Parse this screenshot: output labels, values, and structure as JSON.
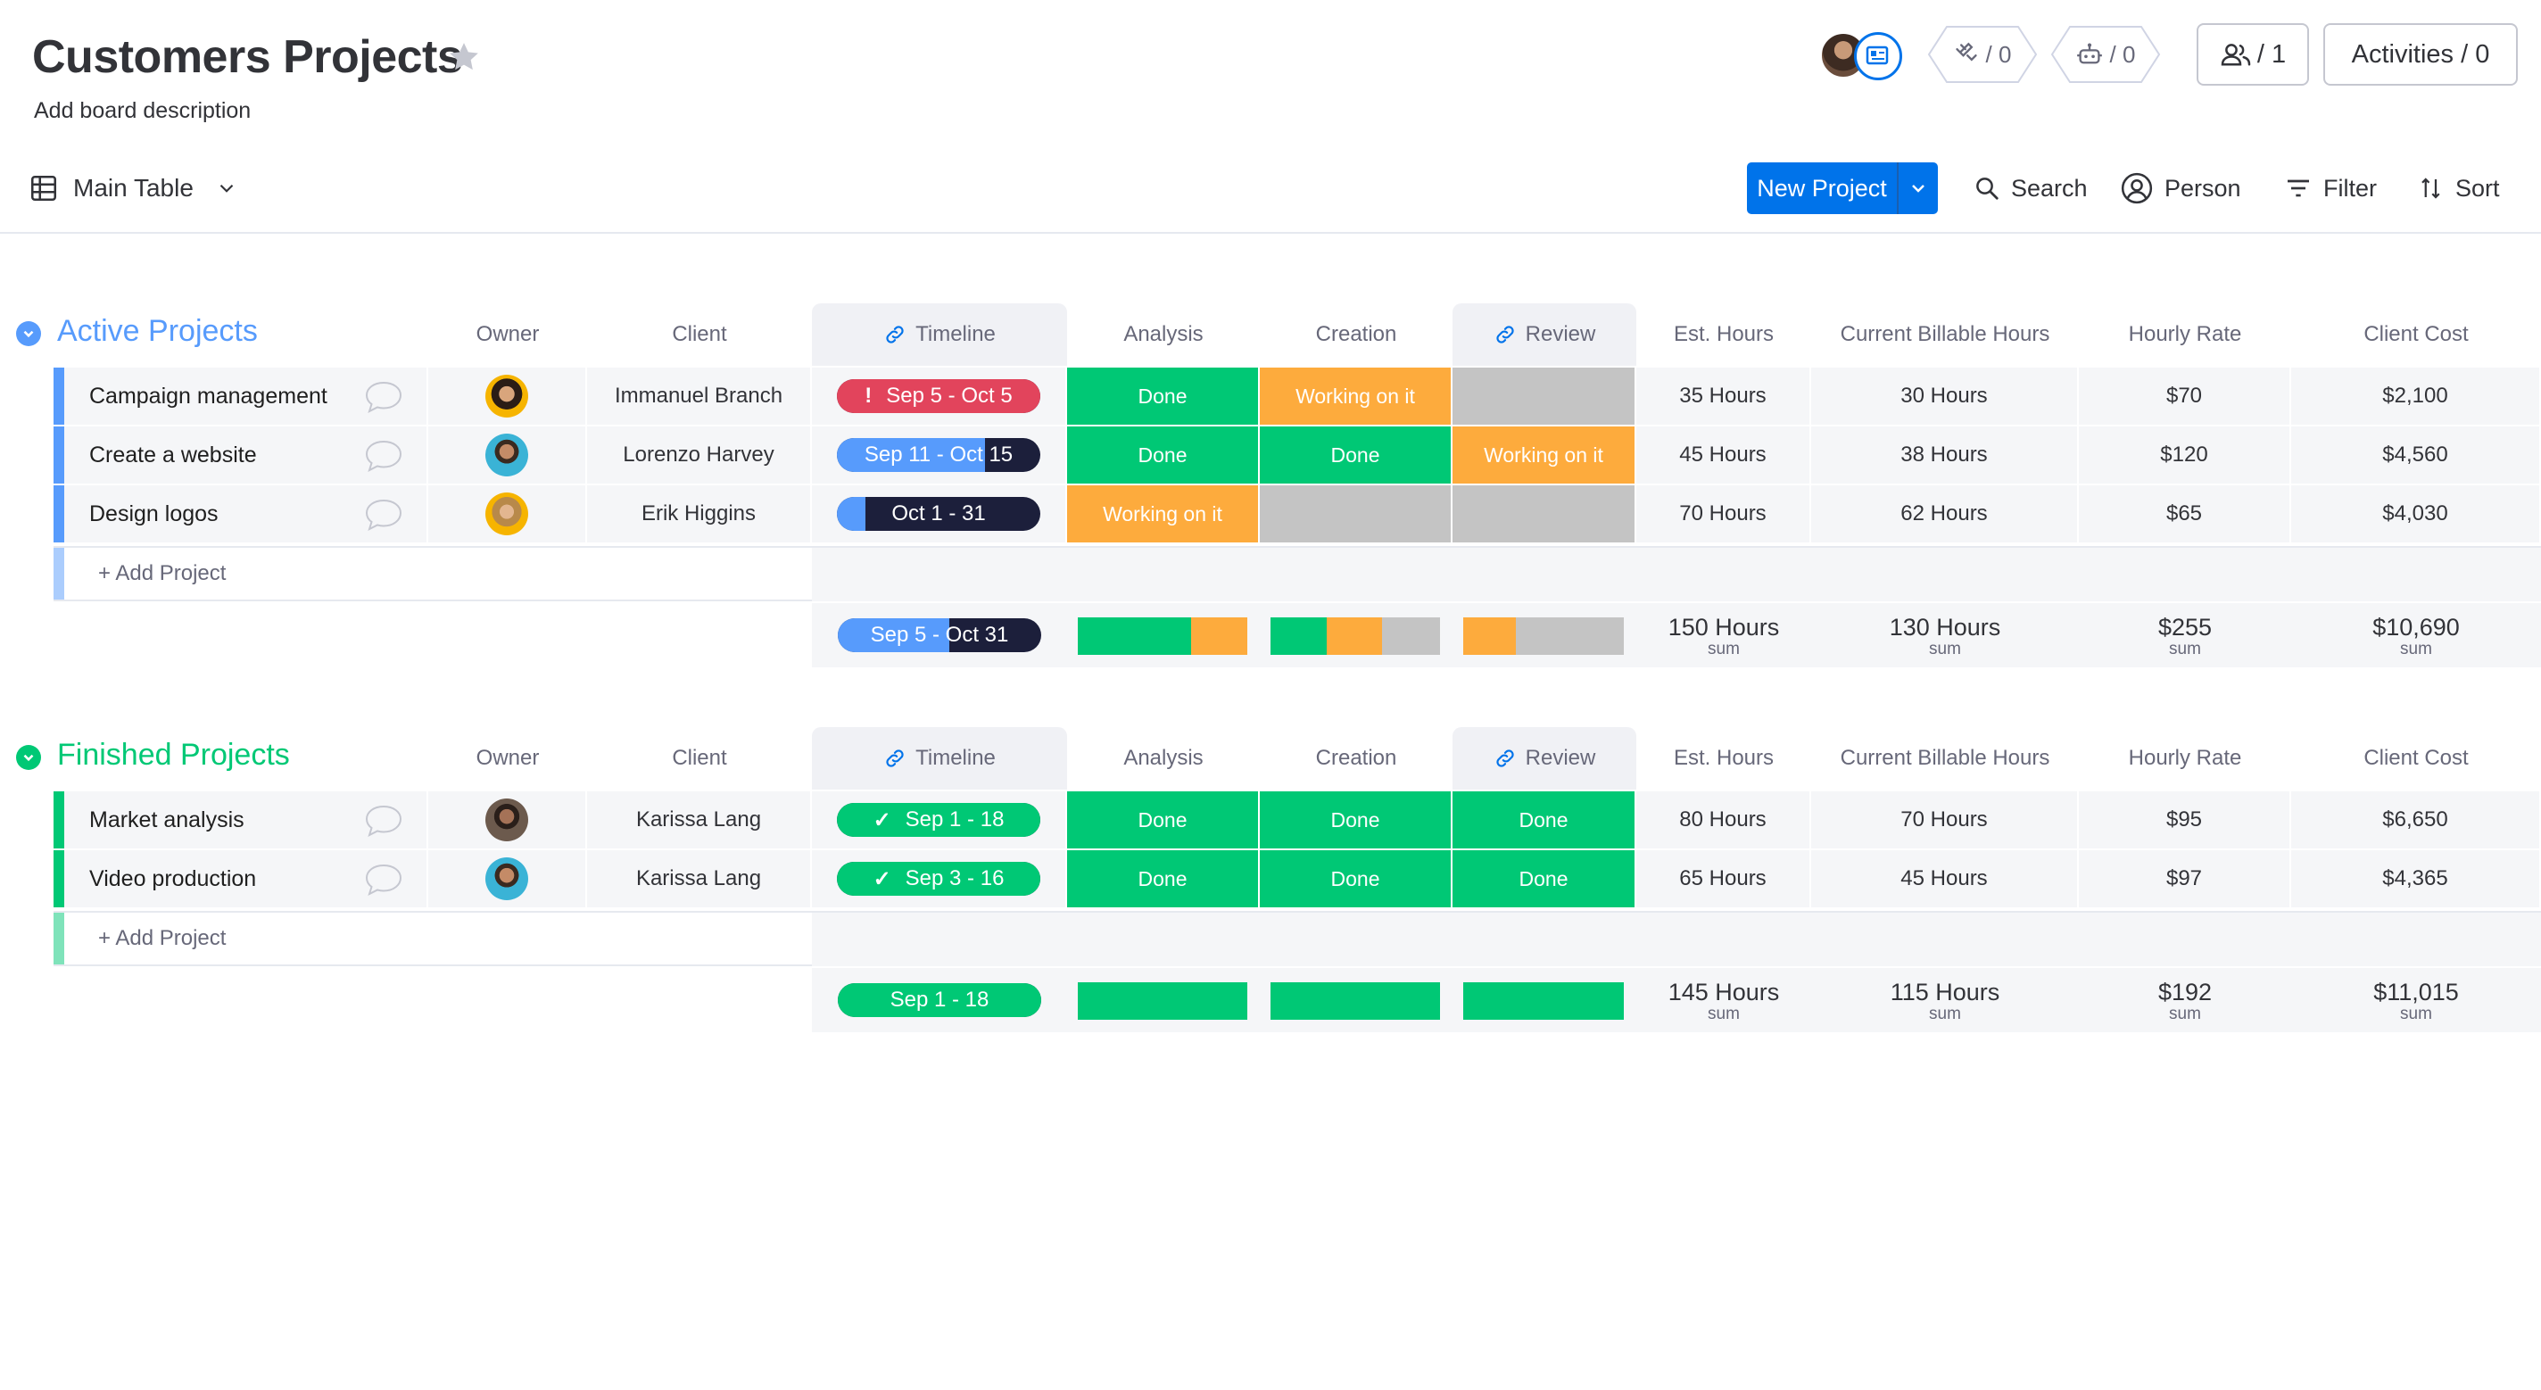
{
  "board": {
    "title": "Customers Projects",
    "description": "Add board description"
  },
  "header": {
    "integrations_count": "/ 0",
    "automations_count": "/ 0",
    "members_label": "/ 1",
    "activities_label": "Activities / 0"
  },
  "toolbar": {
    "view_name": "Main Table",
    "new_item_label": "New Project",
    "search_label": "Search",
    "person_label": "Person",
    "filter_label": "Filter",
    "sort_label": "Sort"
  },
  "columns": {
    "owner": "Owner",
    "client": "Client",
    "timeline": "Timeline",
    "analysis": "Analysis",
    "creation": "Creation",
    "review": "Review",
    "est_hours": "Est. Hours",
    "billable_hours": "Current Billable Hours",
    "hourly_rate": "Hourly Rate",
    "client_cost": "Client Cost"
  },
  "colors": {
    "done": "#00c875",
    "working": "#fdab3d",
    "empty": "#c4c4c4",
    "stuck": "#e2445c",
    "active_group": "#579bfc",
    "finished_group": "#00c875",
    "timeline_blue": "#579bfc",
    "timeline_dark": "#1c1f3b"
  },
  "groups": [
    {
      "title": "Active Projects",
      "color": "#579bfc",
      "add_label": "+ Add Project",
      "rows": [
        {
          "name": "Campaign management",
          "owner_avatar": "avatar-woman-dark-hair",
          "client": "Immanuel Branch",
          "timeline": {
            "label": "Sep 5 - Oct 5",
            "progress": 1.0,
            "fill": "#e2445c",
            "alert": "!"
          },
          "analysis": {
            "label": "Done",
            "color": "#00c875"
          },
          "creation": {
            "label": "Working on it",
            "color": "#fdab3d"
          },
          "review": {
            "label": "",
            "color": "#c4c4c4"
          },
          "est_hours": "35 Hours",
          "billable_hours": "30 Hours",
          "hourly_rate": "$70",
          "client_cost": "$2,100"
        },
        {
          "name": "Create a website",
          "owner_avatar": "avatar-man-beard",
          "client": "Lorenzo Harvey",
          "timeline": {
            "label": "Sep 11 - Oct 15",
            "progress": 0.73,
            "fill": "#579bfc",
            "alert": ""
          },
          "analysis": {
            "label": "Done",
            "color": "#00c875"
          },
          "creation": {
            "label": "Done",
            "color": "#00c875"
          },
          "review": {
            "label": "Working on it",
            "color": "#fdab3d"
          },
          "est_hours": "45 Hours",
          "billable_hours": "38 Hours",
          "hourly_rate": "$120",
          "client_cost": "$4,560"
        },
        {
          "name": "Design logos",
          "owner_avatar": "avatar-woman-blonde",
          "client": "Erik Higgins",
          "timeline": {
            "label": "Oct 1 - 31",
            "progress": 0.14,
            "fill": "#579bfc",
            "alert": ""
          },
          "analysis": {
            "label": "Working on it",
            "color": "#fdab3d"
          },
          "creation": {
            "label": "",
            "color": "#c4c4c4"
          },
          "review": {
            "label": "",
            "color": "#c4c4c4"
          },
          "est_hours": "70 Hours",
          "billable_hours": "62 Hours",
          "hourly_rate": "$65",
          "client_cost": "$4,030"
        }
      ],
      "summary": {
        "timeline": {
          "label": "Sep 5 - Oct 31",
          "progress": 0.55
        },
        "analysis_dist": [
          {
            "color": "#00c875",
            "share": 0.67
          },
          {
            "color": "#fdab3d",
            "share": 0.33
          }
        ],
        "creation_dist": [
          {
            "color": "#00c875",
            "share": 0.33
          },
          {
            "color": "#fdab3d",
            "share": 0.33
          },
          {
            "color": "#c4c4c4",
            "share": 0.34
          }
        ],
        "review_dist": [
          {
            "color": "#fdab3d",
            "share": 0.33
          },
          {
            "color": "#c4c4c4",
            "share": 0.67
          }
        ],
        "est_hours": "150 Hours",
        "billable_hours": "130 Hours",
        "hourly_rate": "$255",
        "client_cost": "$10,690",
        "sum_label": "sum"
      }
    },
    {
      "title": "Finished Projects",
      "color": "#00c875",
      "add_label": "+ Add Project",
      "rows": [
        {
          "name": "Market analysis",
          "owner_avatar": "avatar-man-dark",
          "client": "Karissa Lang",
          "timeline": {
            "label": "Sep 1 - 18",
            "progress": 1.0,
            "fill": "#00c875",
            "alert": "✓"
          },
          "analysis": {
            "label": "Done",
            "color": "#00c875"
          },
          "creation": {
            "label": "Done",
            "color": "#00c875"
          },
          "review": {
            "label": "Done",
            "color": "#00c875"
          },
          "est_hours": "80 Hours",
          "billable_hours": "70 Hours",
          "hourly_rate": "$95",
          "client_cost": "$6,650"
        },
        {
          "name": "Video production",
          "owner_avatar": "avatar-man-beard",
          "client": "Karissa Lang",
          "timeline": {
            "label": "Sep 3 - 16",
            "progress": 1.0,
            "fill": "#00c875",
            "alert": "✓"
          },
          "analysis": {
            "label": "Done",
            "color": "#00c875"
          },
          "creation": {
            "label": "Done",
            "color": "#00c875"
          },
          "review": {
            "label": "Done",
            "color": "#00c875"
          },
          "est_hours": "65 Hours",
          "billable_hours": "45 Hours",
          "hourly_rate": "$97",
          "client_cost": "$4,365"
        }
      ],
      "summary": {
        "timeline": {
          "label": "Sep 1 - 18",
          "progress": 1.0
        },
        "analysis_dist": [
          {
            "color": "#00c875",
            "share": 1.0
          }
        ],
        "creation_dist": [
          {
            "color": "#00c875",
            "share": 1.0
          }
        ],
        "review_dist": [
          {
            "color": "#00c875",
            "share": 1.0
          }
        ],
        "est_hours": "145 Hours",
        "billable_hours": "115 Hours",
        "hourly_rate": "$192",
        "client_cost": "$11,015",
        "sum_label": "sum"
      }
    }
  ]
}
